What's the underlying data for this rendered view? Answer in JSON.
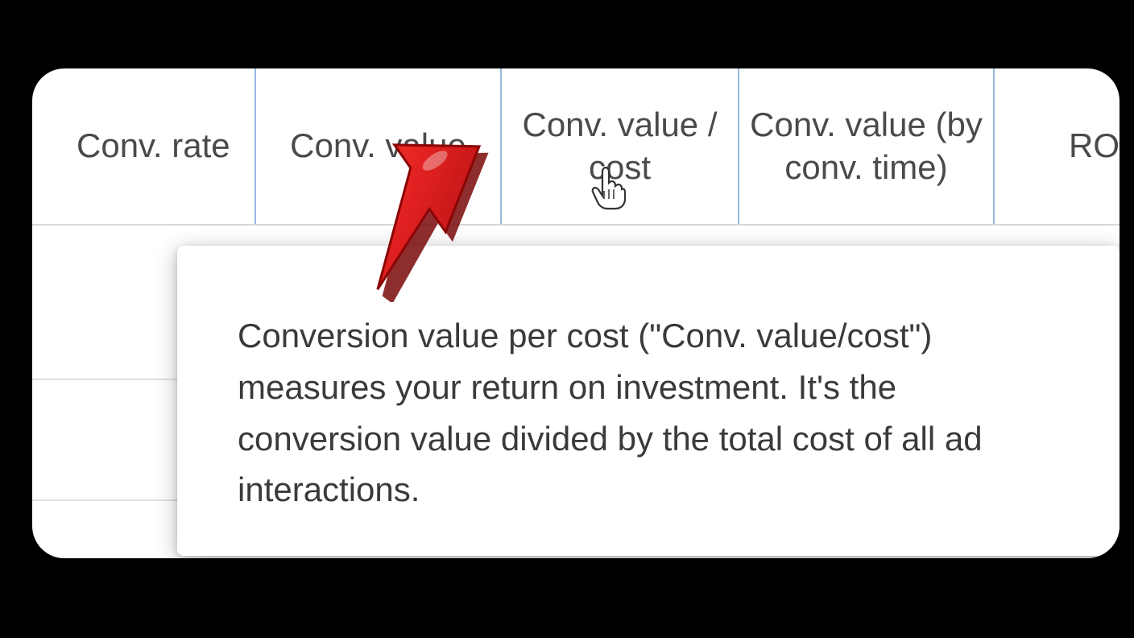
{
  "columns": [
    {
      "label": "Conv. rate"
    },
    {
      "label": "Conv. value"
    },
    {
      "label": "Conv. value / cost"
    },
    {
      "label": "Conv. value (by conv. time)"
    },
    {
      "label": "RO"
    }
  ],
  "tooltip": {
    "text": "Conversion value per cost (\"Conv. value/cost\") measures your return on investment. It's the conversion value divided by the total cost of all ad interactions."
  },
  "annotation": {
    "arrow_color": "#e02020"
  }
}
